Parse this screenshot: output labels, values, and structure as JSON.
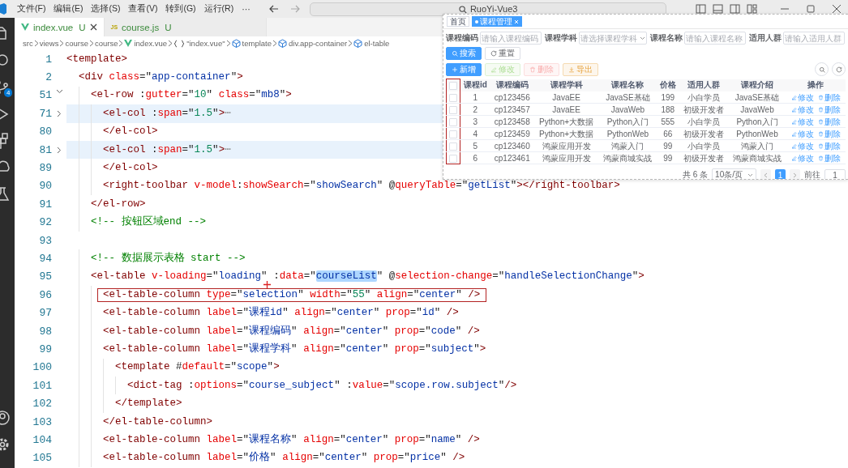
{
  "titlebar": {
    "menus": [
      "文件(F)",
      "编辑(E)",
      "选择(S)",
      "查看(V)",
      "转到(G)",
      "运行(R)",
      "···"
    ],
    "search": "RuoYi-Vue3"
  },
  "activity_bar": {
    "items": [
      {
        "kind": "files"
      },
      {
        "kind": "search"
      },
      {
        "kind": "scm",
        "badge": "4"
      },
      {
        "kind": "run"
      },
      {
        "kind": "extensions"
      },
      {
        "kind": "remote"
      },
      {
        "kind": "testing"
      }
    ],
    "bottom": [
      {
        "kind": "account"
      },
      {
        "kind": "settings"
      }
    ]
  },
  "tabs": [
    {
      "label": "index.vue",
      "status": "U",
      "kind": "vue",
      "selected": true
    },
    {
      "label": "course.js",
      "status": "U",
      "kind": "js",
      "icon_text": "JS",
      "selected": false
    }
  ],
  "breadcrumb": [
    {
      "label": "src",
      "kind": "plain"
    },
    {
      "label": "views",
      "kind": "plain"
    },
    {
      "label": "course",
      "kind": "plain"
    },
    {
      "label": "course",
      "kind": "plain"
    },
    {
      "label": "index.vue",
      "kind": "vue"
    },
    {
      "label": "\"index.vue\"",
      "kind": "braces"
    },
    {
      "label": "template",
      "kind": "cube"
    },
    {
      "label": "div.app-container",
      "kind": "cube"
    },
    {
      "label": "el-table",
      "kind": "cube"
    }
  ],
  "code": {
    "lines": [
      {
        "number": "1",
        "text": "<template>",
        "highlighted": false,
        "boxed": false
      },
      {
        "number": "2",
        "text": "  <div class=\"app-container\">",
        "highlighted": false,
        "boxed": false
      },
      {
        "number": "51",
        "text": "    <el-row :gutter=\"10\" class=\"mb8\">",
        "fold_collapsed": false,
        "highlighted": false,
        "boxed": false
      },
      {
        "number": "71",
        "text": "      <el-col :span=\"1.5\">⋯",
        "fold_collapsed": true,
        "highlighted": true,
        "boxed": false
      },
      {
        "number": "80",
        "text": "      </el-col>",
        "highlighted": false,
        "boxed": false
      },
      {
        "number": "81",
        "text": "      <el-col :span=\"1.5\">⋯",
        "fold_collapsed": true,
        "highlighted": true,
        "boxed": false
      },
      {
        "number": "89",
        "text": "      </el-col>",
        "highlighted": false,
        "boxed": false
      },
      {
        "number": "90",
        "text": "      <right-toolbar v-model:showSearch=\"showSearch\" @queryTable=\"getList\"></right-toolbar>",
        "highlighted": false,
        "boxed": false
      },
      {
        "number": "91",
        "text": "    </el-row>",
        "highlighted": false,
        "boxed": false
      },
      {
        "number": "92",
        "text": "    <!-- 按钮区域end -->",
        "highlighted": false,
        "boxed": false
      },
      {
        "number": "93",
        "highlighted": false
      },
      {
        "number": "94",
        "text": "    <!-- 数据展示表格 start -->",
        "highlighted": false,
        "boxed": false
      },
      {
        "number": "95",
        "parts": [
          {
            "text": "    <el-table v-loading=\"loading\" :data=\"",
            "selected": false
          },
          {
            "text": "courseList",
            "selected": true
          },
          {
            "text": "\" @selection-change=\"handleSelectionChange\">",
            "selected": false
          }
        ],
        "highlighted": false,
        "boxed": false
      },
      {
        "number": "96",
        "text": "      <el-table-column type=\"selection\" width=\"55\" align=\"center\" />",
        "highlighted": false,
        "boxed": true,
        "crosshair": true
      },
      {
        "number": "97",
        "text": "      <el-table-column label=\"课程id\" align=\"center\" prop=\"id\" />",
        "highlighted": false,
        "boxed": false
      },
      {
        "number": "98",
        "text": "      <el-table-column label=\"课程编码\" align=\"center\" prop=\"code\" />",
        "highlighted": false,
        "boxed": false
      },
      {
        "number": "99",
        "text": "      <el-table-column label=\"课程学科\" align=\"center\" prop=\"subject\">",
        "highlighted": false,
        "boxed": false
      },
      {
        "number": "100",
        "text": "        <template #default=\"scope\">",
        "highlighted": false,
        "boxed": false
      },
      {
        "number": "101",
        "text": "          <dict-tag :options=\"course_subject\" :value=\"scope.row.subject\"/>",
        "highlighted": false,
        "boxed": false
      },
      {
        "number": "102",
        "text": "        </template>",
        "highlighted": false,
        "boxed": false
      },
      {
        "number": "103",
        "text": "      </el-table-column>",
        "highlighted": false,
        "boxed": false
      },
      {
        "number": "104",
        "text": "      <el-table-column label=\"课程名称\" align=\"center\" prop=\"name\" />",
        "highlighted": false,
        "boxed": false
      },
      {
        "number": "105",
        "text": "      <el-table-column label=\"价格\" align=\"center\" prop=\"price\" />",
        "highlighted": false,
        "boxed": false
      }
    ]
  },
  "preview": {
    "tags": [
      {
        "label": "首页",
        "selected": false
      },
      {
        "label": "课程管理",
        "selected": true
      }
    ],
    "search_fields": [
      {
        "label": "课程编码",
        "placeholder": "请输入课程编码",
        "kind": "input"
      },
      {
        "label": "课程学科",
        "placeholder": "请选择课程学科",
        "kind": "select"
      },
      {
        "label": "课程名称",
        "placeholder": "请输入课程名称",
        "kind": "input"
      },
      {
        "label": "适用人群",
        "placeholder": "请输入适用人群",
        "kind": "input"
      }
    ],
    "search_buttons": [
      {
        "label": "搜索",
        "kind": "primary"
      },
      {
        "label": "重置",
        "kind": "default"
      }
    ],
    "action_buttons": [
      {
        "label": "新增",
        "kind": "primary",
        "disabled": false
      },
      {
        "label": "修改",
        "kind": "success",
        "disabled": true
      },
      {
        "label": "删除",
        "kind": "danger",
        "disabled": true
      },
      {
        "label": "导出",
        "kind": "warning",
        "disabled": false
      }
    ],
    "table": {
      "annotated": true,
      "header_checked": false,
      "columns": [
        "课程id",
        "课程编码",
        "课程学科",
        "课程名称",
        "价格",
        "适用人群",
        "课程介绍",
        "操作"
      ],
      "rows": [
        {
          "checked": false,
          "cells": [
            "1",
            "cp123456",
            "JavaEE",
            "JavaSE基础",
            "199",
            "小白学员",
            "JavaSE基础"
          ],
          "actions": [
            "修改",
            "删除"
          ]
        },
        {
          "checked": false,
          "cells": [
            "2",
            "cp123457",
            "JavaEE",
            "JavaWeb",
            "188",
            "初级开发者",
            "JavaWeb"
          ],
          "actions": [
            "修改",
            "删除"
          ]
        },
        {
          "checked": false,
          "cells": [
            "3",
            "cp123458",
            "Python+大数据",
            "Python入门",
            "555",
            "小白学员",
            "Python入门"
          ],
          "actions": [
            "修改",
            "删除"
          ]
        },
        {
          "checked": false,
          "cells": [
            "4",
            "cp123459",
            "Python+大数据",
            "PythonWeb",
            "66",
            "初级开发者",
            "PythonWeb"
          ],
          "actions": [
            "修改",
            "删除"
          ]
        },
        {
          "checked": false,
          "cells": [
            "5",
            "cp123460",
            "鸿蒙应用开发",
            "鸿蒙入门",
            "99",
            "小白学员",
            "鸿蒙入门"
          ],
          "actions": [
            "修改",
            "删除"
          ]
        },
        {
          "checked": false,
          "cells": [
            "6",
            "cp123461",
            "鸿蒙应用开发",
            "鸿蒙商城实战",
            "99",
            "初级开发者",
            "鸿蒙商城实战"
          ],
          "actions": [
            "修改",
            "删除"
          ]
        }
      ]
    },
    "pagination": {
      "total": "共 6 条",
      "page_size": "10条/页",
      "pages": [
        {
          "label": "1",
          "selected": true
        }
      ],
      "goto_label": "前往",
      "goto_value": "1"
    }
  }
}
